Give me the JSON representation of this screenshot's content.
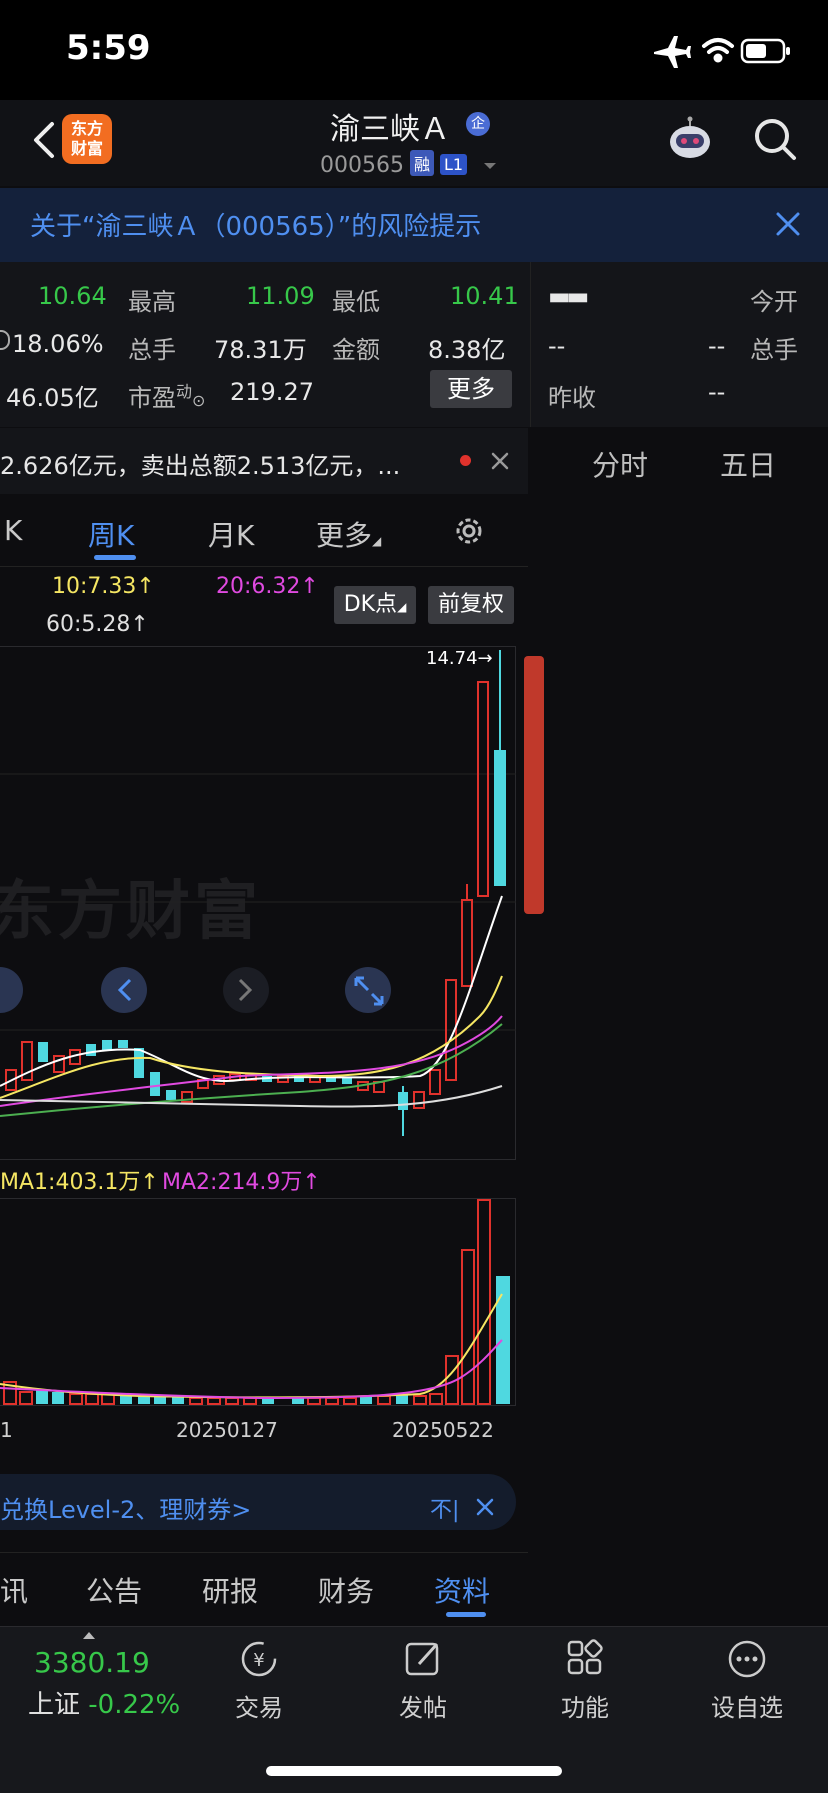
{
  "status": {
    "time": "5:59"
  },
  "header": {
    "stock_name": "渝三峡Ａ",
    "ent_badge": "企",
    "code": "000565",
    "tag_rong": "融",
    "tag_l1": "L1",
    "logo_line1": "东方",
    "logo_line2": "财富"
  },
  "risk_notice": {
    "text": "关于“渝三峡Ａ（000565）”的风险提示"
  },
  "quote": {
    "row1": {
      "v1": "10.64",
      "high_label": "最高",
      "high": "11.09",
      "low_label": "最低",
      "low": "10.41"
    },
    "row2": {
      "v1": "18.06%",
      "vol_label": "总手",
      "vol": "78.31万",
      "amt_label": "金额",
      "amt": "8.38亿"
    },
    "row3": {
      "v1": "46.05亿",
      "pe_label": "市盈",
      "pe_sup": "动",
      "pe": "219.27",
      "more": "更多"
    }
  },
  "right_quote": {
    "dash_big": "▬▬",
    "open_label": "今开",
    "d1": "--",
    "d2": "--",
    "vol_label": "总手",
    "prev_label": "昨收",
    "d3": "--"
  },
  "notice": {
    "text": "2.626亿元，卖出总额2.513亿元，..."
  },
  "right_tabs": [
    "分时",
    "五日"
  ],
  "kline_tabs": [
    "K",
    "周K",
    "月K",
    "更多"
  ],
  "ma": {
    "ma10": "10:7.33↑",
    "ma20": "20:6.32↑",
    "ma60": "60:5.28↑",
    "dk": "DK点",
    "fq": "前复权"
  },
  "chart": {
    "max_label": "14.74→",
    "watermark": "东方财富"
  },
  "volume": {
    "ma1": "MA1:403.1万↑",
    "ma2": "MA2:214.9万↑"
  },
  "dates": {
    "left": "1",
    "d1": "20250127",
    "d2": "20250522"
  },
  "promo": {
    "text": "兑换Level-2、理财券>",
    "right": "不|"
  },
  "bottom_tabs": [
    "讯",
    "公告",
    "研报",
    "财务",
    "资料"
  ],
  "dock": {
    "index_value": "3380.19",
    "index_name": "上证",
    "index_change": "-0.22%",
    "items": [
      "交易",
      "发帖",
      "功能",
      "设自选"
    ]
  },
  "colors": {
    "up": "#e0322c",
    "down": "#4fd8e0",
    "green": "#37c84a",
    "accent": "#4f8ff0"
  }
}
